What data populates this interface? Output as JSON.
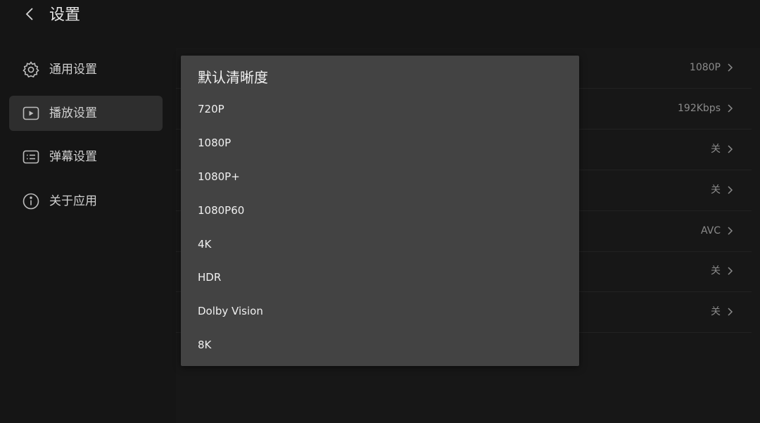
{
  "header": {
    "back_icon": "chevron-left-icon",
    "title": "设置"
  },
  "sidebar": {
    "items": [
      {
        "label": "通用设置",
        "icon": "gear-icon",
        "active": false
      },
      {
        "label": "播放设置",
        "icon": "play-icon",
        "active": true
      },
      {
        "label": "弹幕设置",
        "icon": "danmaku-icon",
        "active": false
      },
      {
        "label": "关于应用",
        "icon": "info-icon",
        "active": false
      }
    ]
  },
  "settings": {
    "rows": [
      {
        "value": "1080P"
      },
      {
        "value": "192Kbps"
      },
      {
        "value": "关"
      },
      {
        "value": "关"
      },
      {
        "value": "AVC"
      },
      {
        "value": "关"
      },
      {
        "value": "关"
      }
    ]
  },
  "dialog": {
    "title": "默认清晰度",
    "options": [
      {
        "label": "720P"
      },
      {
        "label": "1080P"
      },
      {
        "label": "1080P+"
      },
      {
        "label": "1080P60"
      },
      {
        "label": "4K"
      },
      {
        "label": "HDR"
      },
      {
        "label": "Dolby Vision"
      },
      {
        "label": "8K"
      }
    ]
  },
  "colors": {
    "background": "#151515",
    "sidebar_active": "#2e2e2e",
    "dialog_bg": "#434343",
    "text_primary": "#e6e6e6",
    "text_secondary": "#8a8a8a"
  }
}
